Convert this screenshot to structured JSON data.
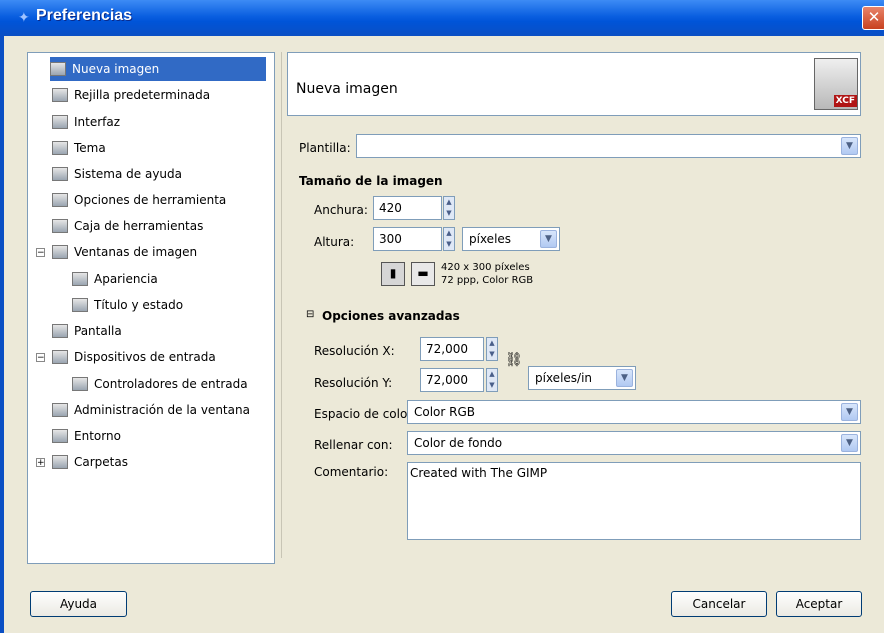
{
  "window": {
    "title": "Preferencias",
    "close_glyph": "✕",
    "title_icon": "wilber-icon"
  },
  "tree": {
    "items": [
      {
        "label": "Nueva imagen",
        "selected": true,
        "icon": "new-image-icon"
      },
      {
        "label": "Rejilla predeterminada",
        "icon": "grid-icon"
      },
      {
        "label": "Interfaz",
        "icon": "interface-icon"
      },
      {
        "label": "Tema",
        "icon": "theme-icon"
      },
      {
        "label": "Sistema de ayuda",
        "icon": "help-system-icon"
      },
      {
        "label": "Opciones de herramienta",
        "icon": "tool-options-icon"
      },
      {
        "label": "Caja de herramientas",
        "icon": "toolbox-icon"
      },
      {
        "label": "Ventanas de imagen",
        "icon": "image-windows-icon",
        "expander": "−"
      },
      {
        "label": "Apariencia",
        "icon": "appearance-icon"
      },
      {
        "label": "Título y estado",
        "icon": "title-status-icon"
      },
      {
        "label": "Pantalla",
        "icon": "display-icon"
      },
      {
        "label": "Dispositivos de entrada",
        "icon": "input-devices-icon",
        "expander": "−"
      },
      {
        "label": "Controladores de entrada",
        "icon": "input-controllers-icon"
      },
      {
        "label": "Administración de la ventana",
        "icon": "window-management-icon"
      },
      {
        "label": "Entorno",
        "icon": "environment-icon"
      },
      {
        "label": "Carpetas",
        "icon": "folders-icon",
        "expander": "+"
      }
    ]
  },
  "header": {
    "title": "Nueva imagen",
    "badge": "XCF"
  },
  "template": {
    "label": "Plantilla:",
    "value": ""
  },
  "image_size": {
    "heading": "Tamaño de la imagen",
    "width_label": "Anchura:",
    "width_value": "420",
    "height_label": "Altura:",
    "height_value": "300",
    "unit": "píxeles",
    "info_line1": "420 x 300 píxeles",
    "info_line2": "72 ppp, Color RGB"
  },
  "advanced": {
    "expander": "⊟",
    "heading": "Opciones avanzadas",
    "xres_label": "Resolución X:",
    "xres_value": "72,000",
    "yres_label": "Resolución Y:",
    "yres_value": "72,000",
    "res_unit": "píxeles/in",
    "colorspace_label": "Espacio de color:",
    "colorspace_value": "Color RGB",
    "fill_label": "Rellenar con:",
    "fill_value": "Color de fondo",
    "comment_label": "Comentario:",
    "comment_value": "Created with The GIMP"
  },
  "buttons": {
    "help": "Ayuda",
    "cancel": "Cancelar",
    "accept": "Aceptar"
  },
  "colors": {
    "titlebar": "#0a5fe0",
    "selection": "#316ac5",
    "dialog_bg": "#ece9d8"
  }
}
